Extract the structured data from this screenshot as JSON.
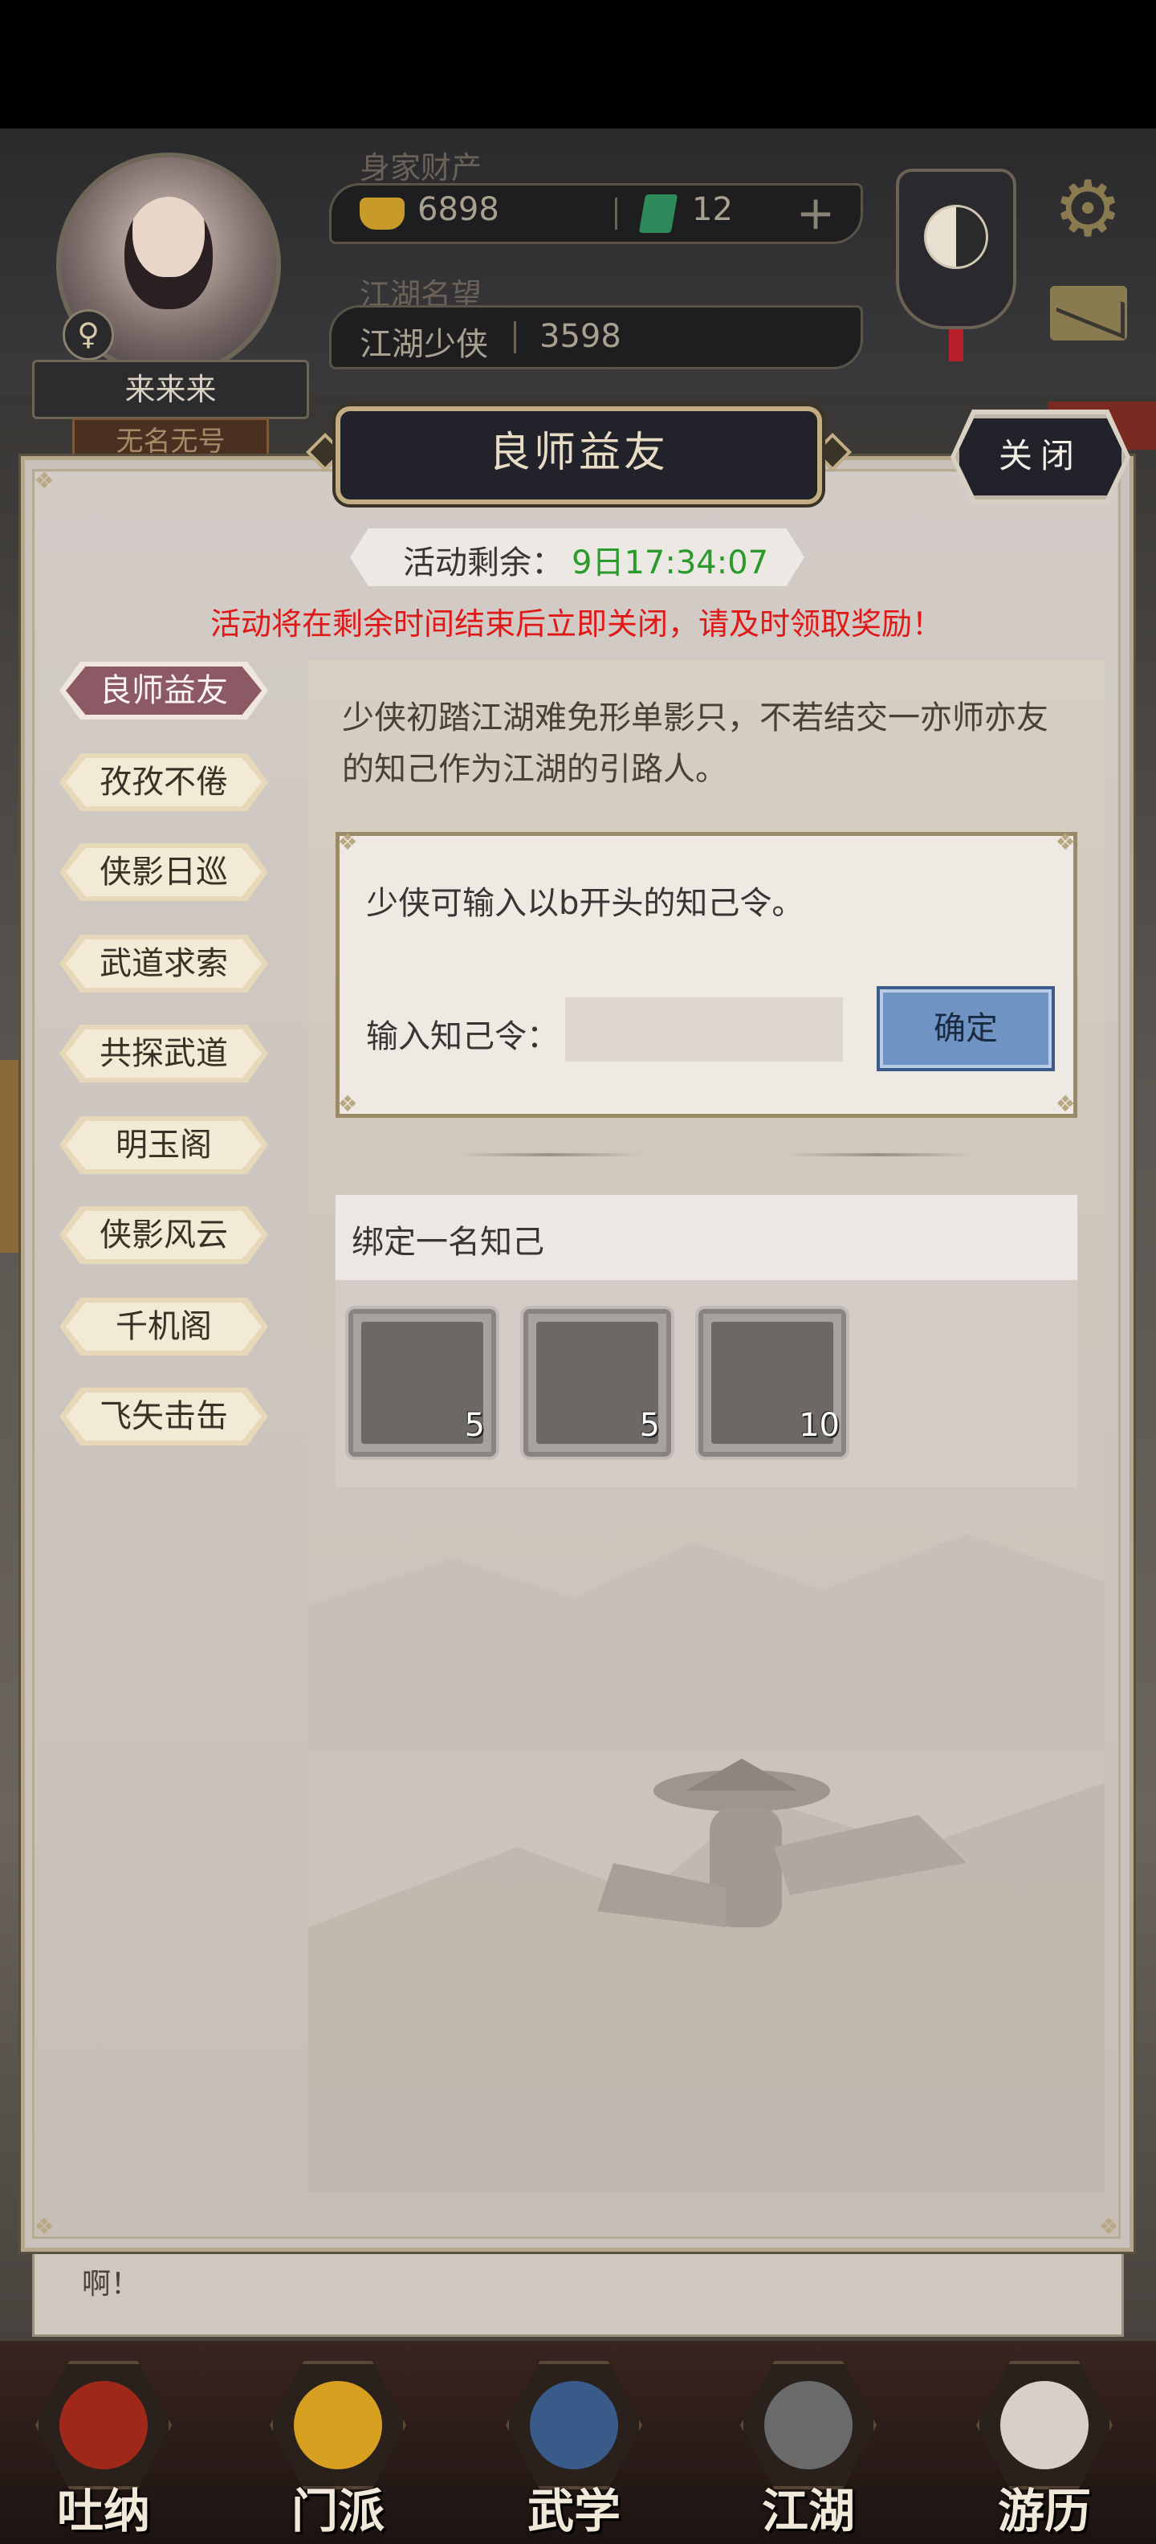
{
  "header": {
    "wealth_label": "身家财产",
    "gold": "6898",
    "jade": "12",
    "plus_symbol": "+",
    "fame_label": "江湖名望",
    "fame_title": "江湖少侠",
    "fame_value": "3598",
    "player_name": "来来来",
    "player_title": "无名无号",
    "gender_symbol": "♀"
  },
  "modal": {
    "title": "良师益友",
    "close_label": "关闭",
    "timer_label": "活动剩余：",
    "timer_value": "9日17:34:07",
    "warning": "活动将在剩余时间结束后立即关闭，请及时领取奖励！"
  },
  "menu": {
    "items": [
      {
        "label": "良师益友",
        "active": true
      },
      {
        "label": "孜孜不倦",
        "active": false
      },
      {
        "label": "侠影日巡",
        "active": false
      },
      {
        "label": "武道求索",
        "active": false
      },
      {
        "label": "共探武道",
        "active": false
      },
      {
        "label": "明玉阁",
        "active": false
      },
      {
        "label": "侠影风云",
        "active": false
      },
      {
        "label": "千机阁",
        "active": false
      },
      {
        "label": "飞矢击缶",
        "active": false
      }
    ]
  },
  "content": {
    "intro": "少侠初踏江湖难免形单影只，不若结交一亦师亦友的知己作为江湖的引路人。",
    "code_hint": "少侠可输入以b开头的知己令。",
    "code_label": "输入知己令：",
    "code_value": "",
    "confirm_label": "确定",
    "bind_title": "绑定一名知己",
    "rewards": [
      {
        "icon": "silver-ingot-icon",
        "count": "5"
      },
      {
        "icon": "treasure-chest-icon",
        "count": "5"
      },
      {
        "icon": "incense-burner-icon",
        "count": "10"
      }
    ]
  },
  "background": {
    "chat_snippet": "啊！"
  },
  "bottom_nav": {
    "tabs": [
      "吐纳",
      "门派",
      "武学",
      "江湖",
      "游历"
    ]
  },
  "colors": {
    "timer_green": "#2a9a2a",
    "warning_red": "#e01818",
    "active_menu": "#8c5a64",
    "confirm_blue": "#6f93c3"
  }
}
